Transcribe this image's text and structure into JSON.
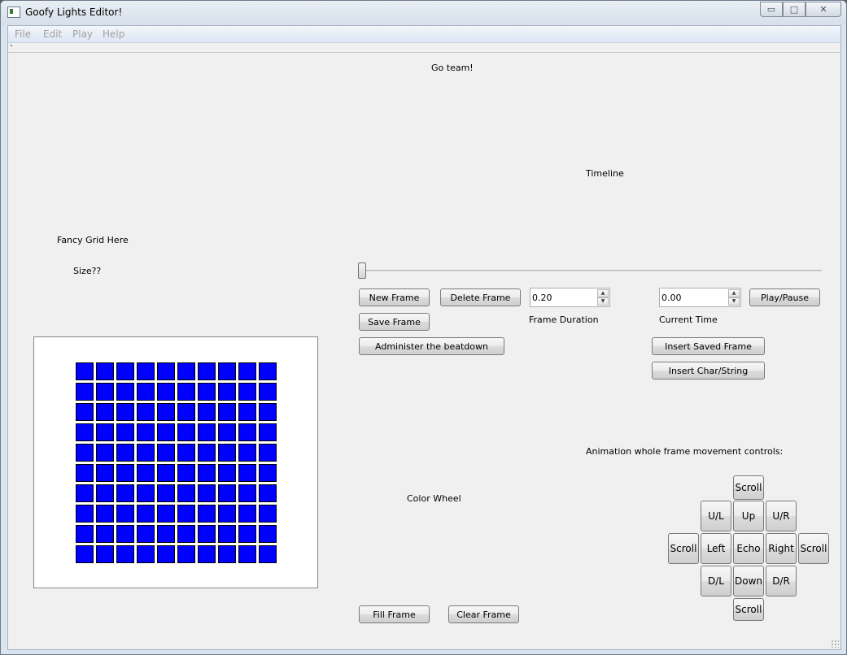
{
  "window": {
    "title": "Goofy Lights Editor!",
    "buttons": {
      "minimize": "▭",
      "maximize": "□",
      "close": "✕"
    }
  },
  "menu": [
    "File",
    "Edit",
    "Play",
    "Help"
  ],
  "labels": {
    "go_team": "Go team!",
    "timeline": "Timeline",
    "fancy_grid": "Fancy Grid Here",
    "size": "Size??",
    "frame_duration": "Frame Duration",
    "current_time": "Current Time",
    "color_wheel": "Color Wheel",
    "animation_controls": "Animation whole frame movement controls:"
  },
  "buttons": {
    "new_frame": "New Frame",
    "delete_frame": "Delete Frame",
    "play_pause": "Play/Pause",
    "save_frame": "Save Frame",
    "administer": "Administer the beatdown",
    "insert_saved_frame": "Insert Saved Frame",
    "insert_char_string": "Insert Char/String",
    "fill_frame": "Fill Frame",
    "clear_frame": "Clear Frame"
  },
  "inputs": {
    "frame_duration_value": "0.20",
    "current_time_value": "0.00"
  },
  "timeline_slider": {
    "value": 0
  },
  "movement": {
    "scroll_up": "Scroll",
    "up_left": "U/L",
    "up": "Up",
    "up_right": "U/R",
    "scroll_left": "Scroll",
    "left": "Left",
    "echo": "Echo",
    "right": "Right",
    "scroll_right": "Scroll",
    "down_left": "D/L",
    "down": "Down",
    "down_right": "D/R",
    "scroll_down": "Scroll"
  },
  "grid": {
    "rows": 10,
    "cols": 10,
    "cell_color": "#0000ff"
  }
}
